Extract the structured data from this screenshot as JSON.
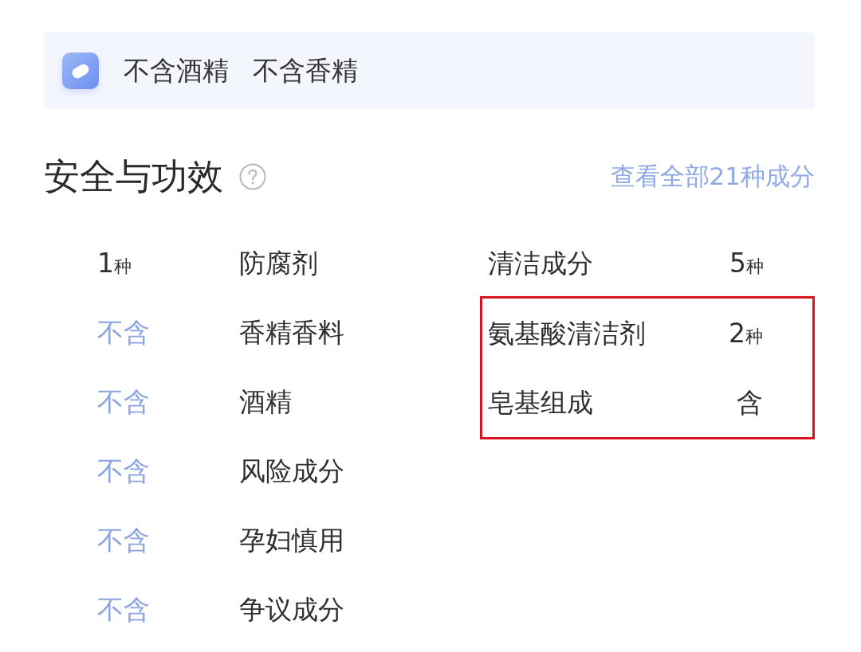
{
  "banner": {
    "tags": [
      "不含酒精",
      "不含香精"
    ]
  },
  "section": {
    "title": "安全与功效",
    "link": "查看全部21种成分"
  },
  "left_column": [
    {
      "value": "1",
      "unit": "种",
      "kind": "count",
      "name": "防腐剂"
    },
    {
      "value": "不含",
      "kind": "absent",
      "name": "香精香料"
    },
    {
      "value": "不含",
      "kind": "absent",
      "name": "酒精"
    },
    {
      "value": "不含",
      "kind": "absent",
      "name": "风险成分"
    },
    {
      "value": "不含",
      "kind": "absent",
      "name": "孕妇慎用"
    },
    {
      "value": "不含",
      "kind": "absent",
      "name": "争议成分"
    }
  ],
  "right_column": [
    {
      "name": "清洁成分",
      "value": "5",
      "unit": "种",
      "highlighted": false
    },
    {
      "name": "氨基酸清洁剂",
      "value": "2",
      "unit": "种",
      "highlighted": true
    },
    {
      "name": "皂基组成",
      "value": "含",
      "highlighted": true
    }
  ]
}
